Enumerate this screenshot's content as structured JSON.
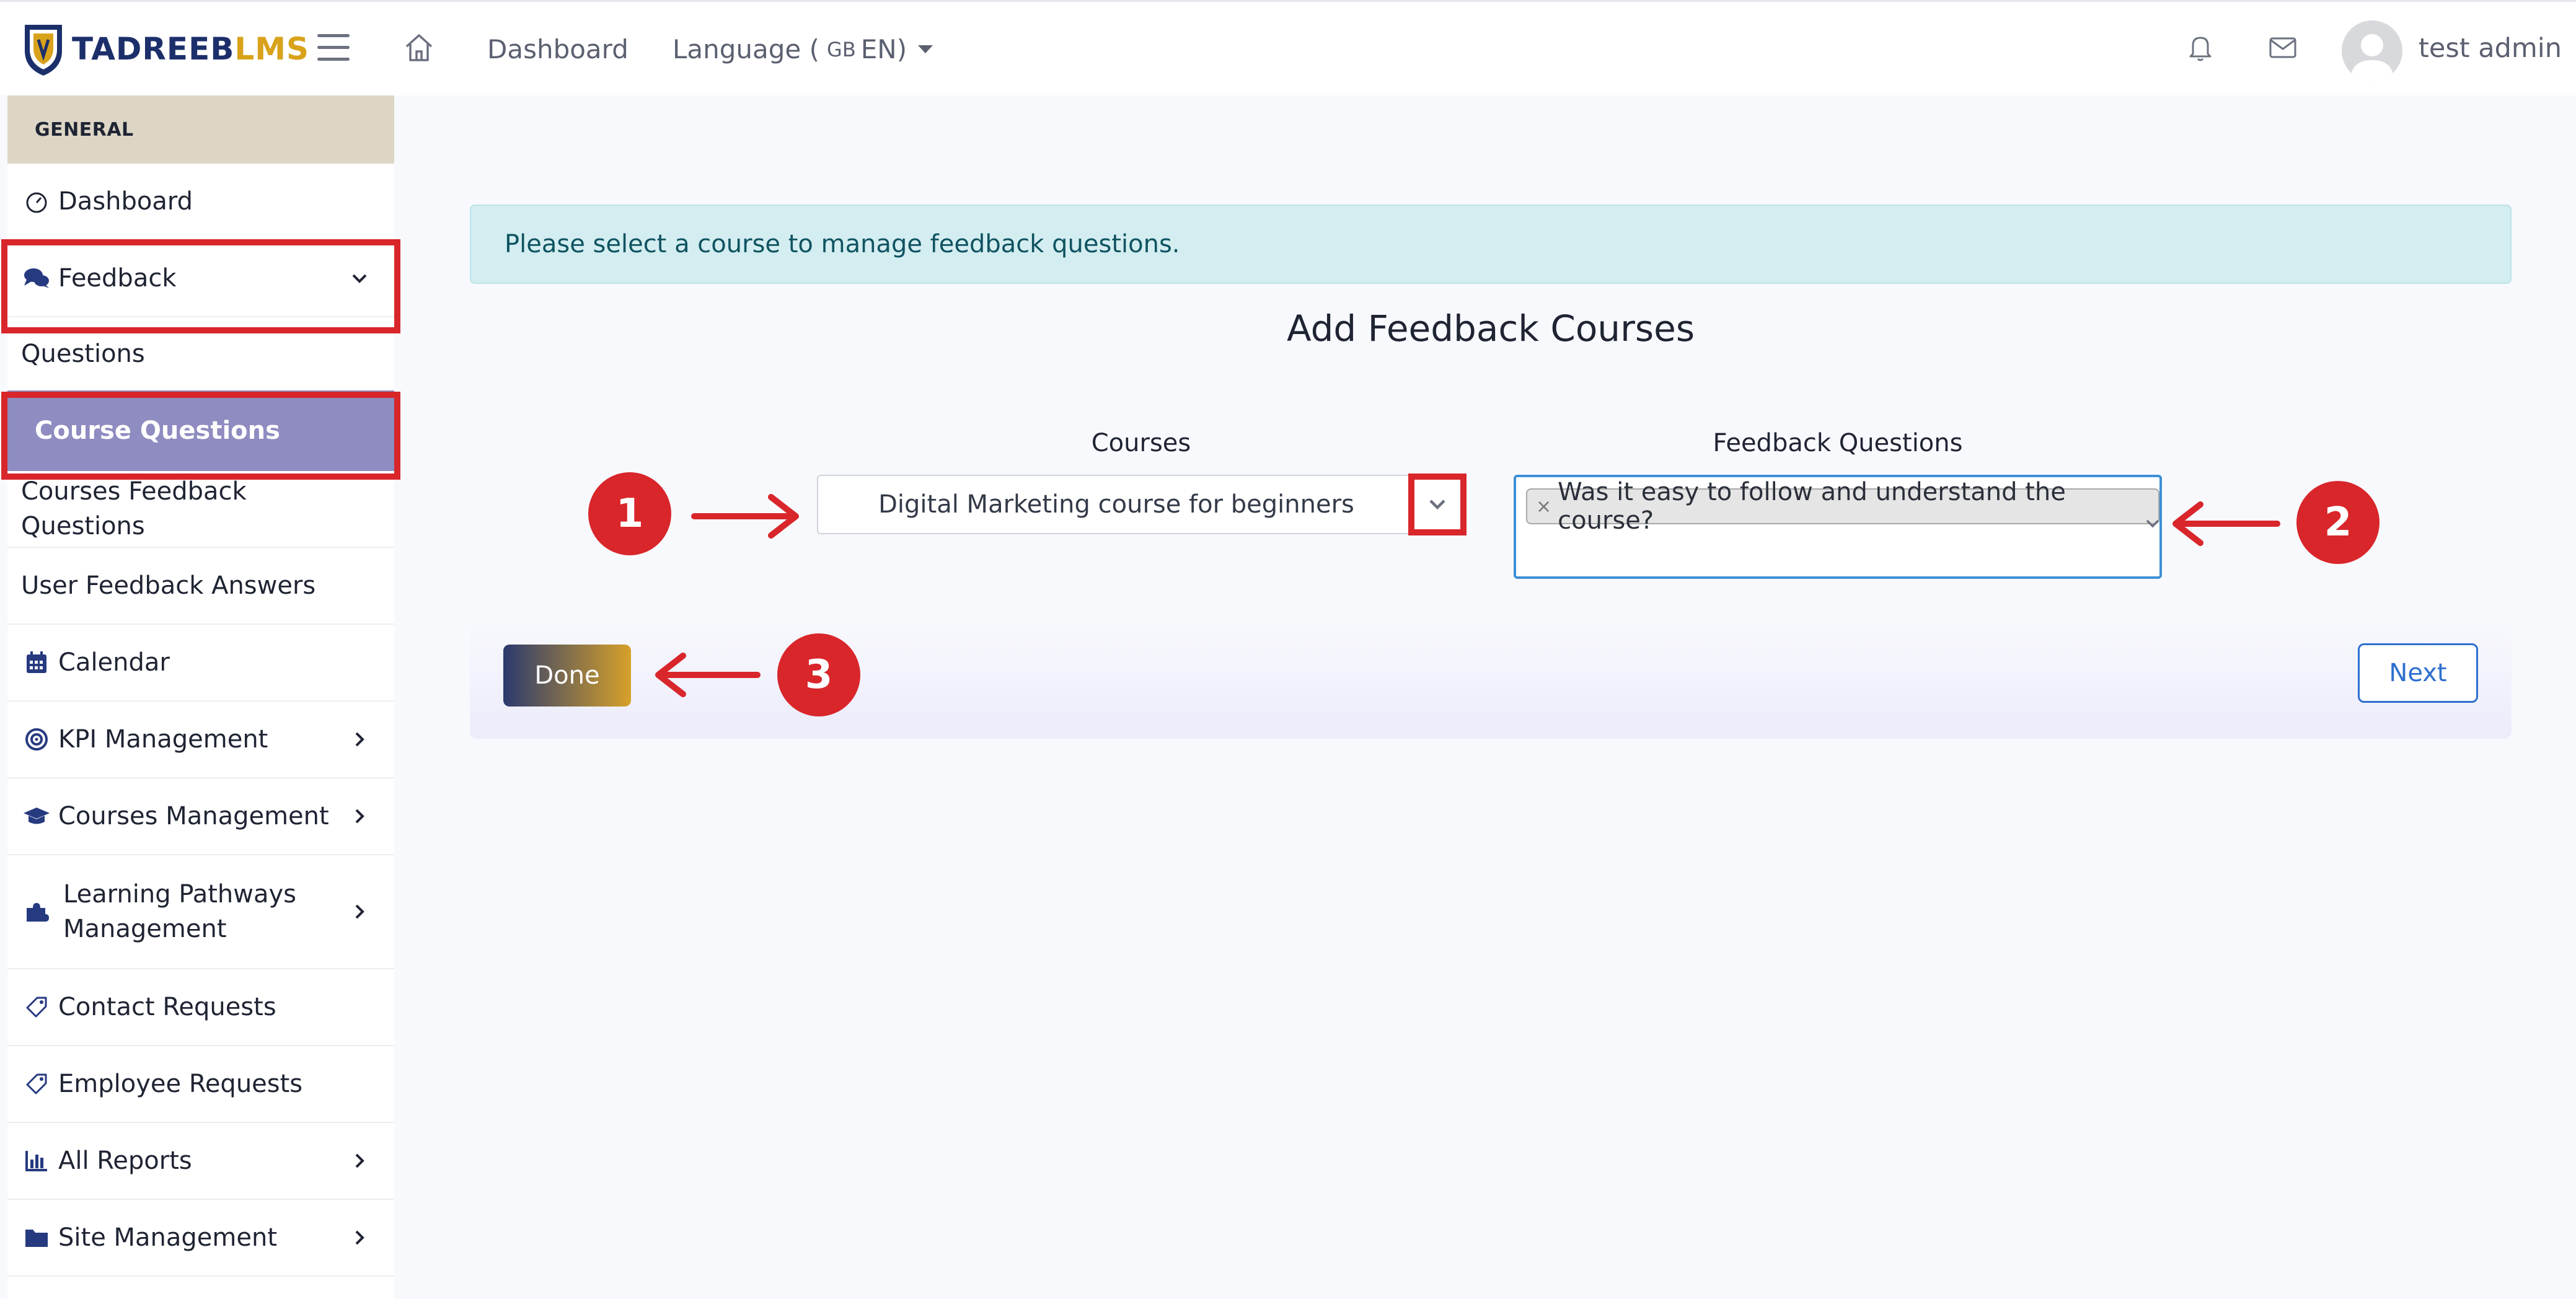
{
  "header": {
    "logo_part1": "TADREEB",
    "logo_part2": "LMS",
    "nav_dashboard": "Dashboard",
    "language_label": "Language (",
    "language_flag": "GB",
    "language_code": " EN)",
    "user_name": "test admin"
  },
  "sidebar": {
    "section": "GENERAL",
    "items": [
      {
        "label": "Dashboard",
        "icon": "gauge-icon"
      },
      {
        "label": "Feedback",
        "icon": "comments-icon"
      },
      {
        "label": "Questions"
      },
      {
        "label": "Course Questions"
      },
      {
        "label": "Courses Feedback Questions"
      },
      {
        "label": "User Feedback Answers"
      },
      {
        "label": "Calendar",
        "icon": "calendar-icon"
      },
      {
        "label": "KPI Management",
        "icon": "target-icon"
      },
      {
        "label": "Courses Management",
        "icon": "graduation-cap-icon"
      },
      {
        "label": "Learning Pathways Management",
        "icon": "puzzle-icon"
      },
      {
        "label": "Contact Requests",
        "icon": "tag-icon"
      },
      {
        "label": "Employee Requests",
        "icon": "tag-icon"
      },
      {
        "label": "All Reports",
        "icon": "bar-chart-icon"
      },
      {
        "label": "Site Management",
        "icon": "folder-icon"
      }
    ]
  },
  "main": {
    "alert": "Please select a course to manage feedback questions.",
    "title": "Add Feedback Courses",
    "courses_label": "Courses",
    "courses_value": "Digital Marketing course for beginners",
    "fq_label": "Feedback Questions",
    "fq_selected": "Was it easy to follow and understand the course?",
    "tag_remove": "×",
    "done": "Done",
    "next": "Next"
  },
  "markers": [
    "1",
    "2",
    "3"
  ],
  "colors": {
    "accent_red": "#d8262b",
    "brand_navy": "#1c2f6b",
    "brand_gold": "#d9a21b",
    "active_item": "#8e8cc0",
    "alert_bg": "#d3edf1"
  }
}
